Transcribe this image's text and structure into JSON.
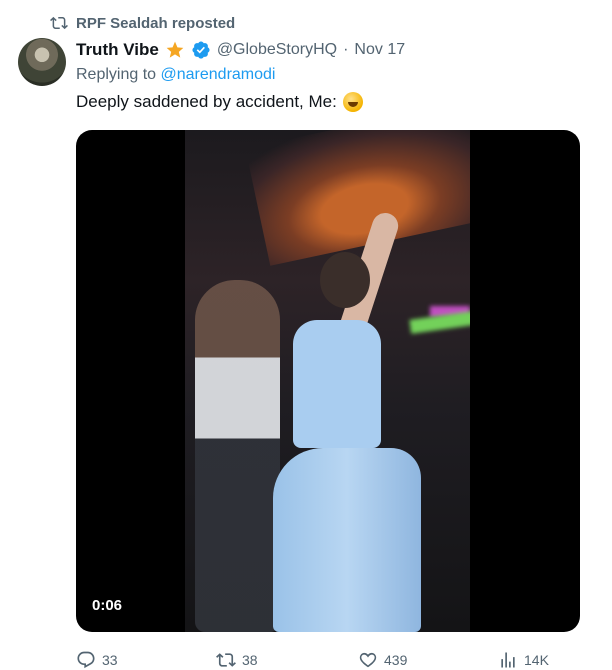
{
  "repost": {
    "label": "RPF Sealdah reposted",
    "icon": "retweet-icon"
  },
  "author": {
    "name": "Truth Vibe",
    "handle": "@GlobeStoryHQ",
    "separator": "·",
    "date": "Nov 17",
    "badges": [
      "star-icon",
      "verified-icon"
    ]
  },
  "reply": {
    "prefix": "Replying to",
    "mention": "@narendramodi"
  },
  "tweet": {
    "text": "Deeply saddened by accident, Me:"
  },
  "media": {
    "duration": "0:06"
  },
  "actions": {
    "reply_count": "33",
    "repost_count": "38",
    "like_count": "439",
    "view_count": "14K"
  },
  "colors": {
    "link": "#1d9bf0",
    "secondary_text": "#536471",
    "primary_text": "#0f1419",
    "verified": "#1d9bf0",
    "star": "#f5a623"
  }
}
